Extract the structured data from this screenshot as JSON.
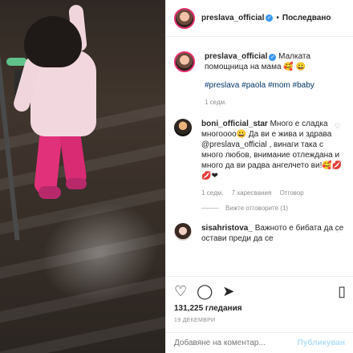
{
  "post": {
    "username": "preslava_official",
    "follow_label": "Последвано",
    "dot": "•"
  },
  "caption": {
    "username": "preslava_official",
    "text": "Малката помощница на мама 🥰 😀",
    "hashtags": "#preslava #paola #mom #baby",
    "time": "1 седм."
  },
  "comments": [
    {
      "username": "boni_official_star",
      "text": "Много е сладка многоооо😀 Да ви е жива и здрава @preslava_official , винаги така с много любов, внимание отлеждана и много да ви радва ангелчето ви!🥰💋💋❤",
      "time": "1 седм.",
      "likes": "7 харесвания",
      "reply": "Отговор",
      "view_replies": "Вижте отговорите (1)"
    },
    {
      "username": "sisahristova_",
      "text": "Важното е бибата да се остави преди да се"
    }
  ],
  "actions": {
    "likes": "131,225 гледания",
    "date": "19 ДЕКЕМВРИ"
  },
  "comment_box": {
    "placeholder": "Добавяне на коментар...",
    "publish": "Публикуван"
  },
  "icons": {
    "heart": "heart-icon",
    "comment": "comment-icon",
    "share": "share-icon",
    "bookmark": "bookmark-icon",
    "more": "more-icon"
  }
}
